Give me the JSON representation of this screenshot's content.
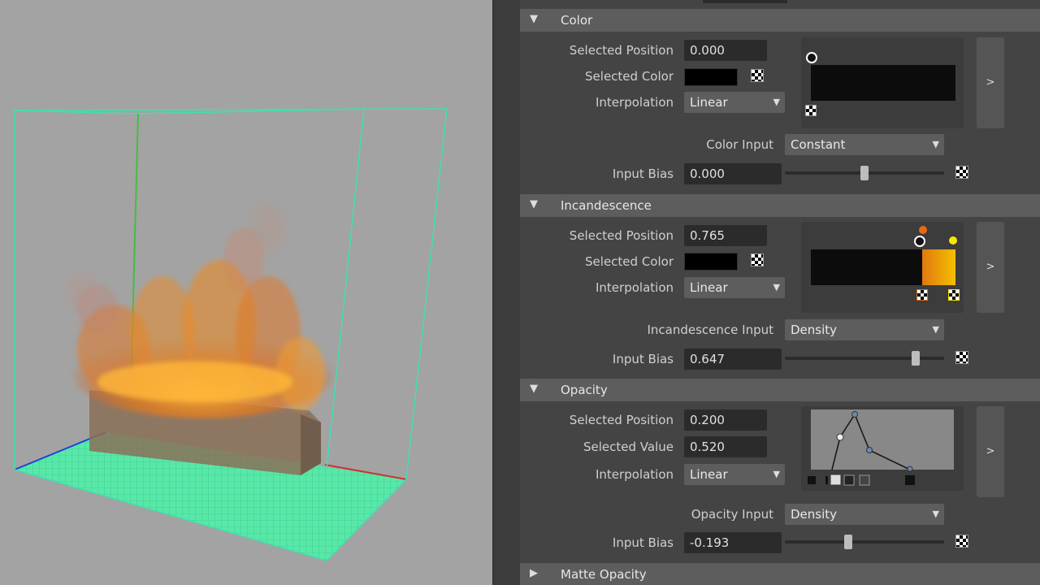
{
  "color_section": {
    "title": "Color",
    "selected_position_label": "Selected Position",
    "selected_position_value": "0.000",
    "selected_color_label": "Selected Color",
    "interpolation_label": "Interpolation",
    "interpolation_value": "Linear",
    "input_label": "Color Input",
    "input_value": "Constant",
    "bias_label": "Input Bias",
    "bias_value": "0.000",
    "bias_slider_fraction": 0.5,
    "expand_label": ">"
  },
  "incandescence_section": {
    "title": "Incandescence",
    "selected_position_label": "Selected Position",
    "selected_position_value": "0.765",
    "selected_color_label": "Selected Color",
    "interpolation_label": "Interpolation",
    "interpolation_value": "Linear",
    "input_label": "Incandescence Input",
    "input_value": "Density",
    "bias_label": "Input Bias",
    "bias_value": "0.647",
    "bias_slider_fraction": 0.82,
    "expand_label": ">"
  },
  "opacity_section": {
    "title": "Opacity",
    "selected_position_label": "Selected Position",
    "selected_position_value": "0.200",
    "selected_value_label": "Selected Value",
    "selected_value_value": "0.520",
    "interpolation_label": "Interpolation",
    "interpolation_value": "Linear",
    "input_label": "Opacity Input",
    "input_value": "Density",
    "bias_label": "Input Bias",
    "bias_value": "-0.193",
    "bias_slider_fraction": 0.4,
    "expand_label": ">"
  },
  "matte_section": {
    "title": "Matte Opacity"
  },
  "colors": {
    "flame_orange": "#f08a1c",
    "incandescence_yellow": "#f5c000",
    "bounding_box": "#3fe0b0",
    "ground_grid": "#46e0a0"
  }
}
